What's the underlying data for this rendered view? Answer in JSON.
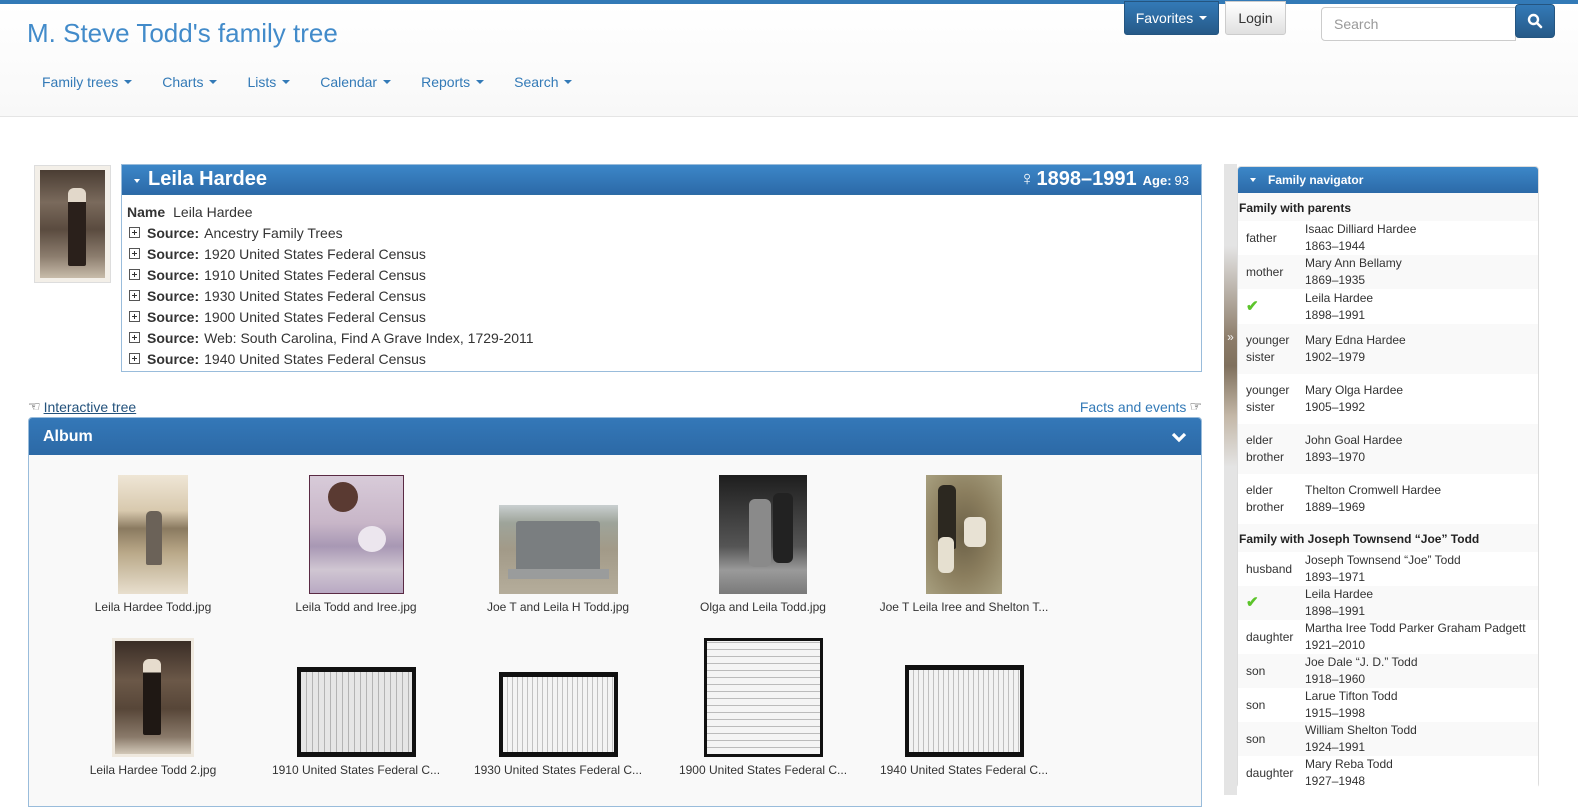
{
  "header": {
    "site_title": "M. Steve Todd's family tree",
    "menu": [
      {
        "label": "Family trees"
      },
      {
        "label": "Charts"
      },
      {
        "label": "Lists"
      },
      {
        "label": "Calendar"
      },
      {
        "label": "Reports"
      },
      {
        "label": "Search"
      }
    ],
    "favorites_label": "Favorites",
    "login_label": "Login",
    "search_placeholder": "Search",
    "search_value": ""
  },
  "colors": {
    "accent": "#337ab7",
    "link": "#428bca",
    "check": "#5cc42b"
  },
  "individual": {
    "name": "Leila Hardee",
    "sex_icon": "female-icon",
    "sex_symbol": "♀",
    "dates": "1898–1991",
    "age_label": "Age:",
    "age": "93",
    "name_fact_label": "Name",
    "name_fact_value": "Leila Hardee",
    "source_label": "Source:",
    "sources": [
      "Ancestry Family Trees",
      "1920 United States Federal Census",
      "1910 United States Federal Census",
      "1930 United States Federal Census",
      "1900 United States Federal Census",
      "Web: South Carolina, Find A Grave Index, 1729-2011",
      "1940 United States Federal Census"
    ]
  },
  "links": {
    "interactive_tree": "Interactive tree",
    "facts_and_events": "Facts and events"
  },
  "album": {
    "title": "Album",
    "items": [
      {
        "caption": "Leila Hardee Todd.jpg"
      },
      {
        "caption": "Leila Todd and Iree.jpg"
      },
      {
        "caption": "Joe T and Leila H Todd.jpg"
      },
      {
        "caption": "Olga and Leila Todd.jpg"
      },
      {
        "caption": "Joe T Leila Iree and Shelton T..."
      },
      {
        "caption": "Leila Hardee Todd 2.jpg"
      },
      {
        "caption": "1910 United States Federal C..."
      },
      {
        "caption": "1930 United States Federal C..."
      },
      {
        "caption": "1900 United States Federal C..."
      },
      {
        "caption": "1940 United States Federal C..."
      }
    ]
  },
  "family_navigator": {
    "title": "Family navigator",
    "families": [
      {
        "label": "Family with parents",
        "members": [
          {
            "relation": "father",
            "name": "Isaac Dilliard Hardee",
            "dates": "1863–1944"
          },
          {
            "relation": "mother",
            "name": "Mary Ann Bellamy",
            "dates": "1869–1935"
          },
          {
            "relation": "",
            "self": true,
            "name": "Leila Hardee",
            "dates": "1898–1991"
          },
          {
            "relation": "younger sister",
            "name": "Mary Edna Hardee",
            "dates": "1902–1979"
          },
          {
            "relation": "younger sister",
            "name": "Mary Olga Hardee",
            "dates": "1905–1992"
          },
          {
            "relation": "elder brother",
            "name": "John Goal Hardee",
            "dates": "1893–1970"
          },
          {
            "relation": "elder brother",
            "name": "Thelton Cromwell Hardee",
            "dates": "1889–1969"
          }
        ]
      },
      {
        "label": "Family with Joseph Townsend “Joe” Todd",
        "members": [
          {
            "relation": "husband",
            "name": "Joseph Townsend “Joe” Todd",
            "dates": "1893–1971"
          },
          {
            "relation": "",
            "self": true,
            "name": "Leila Hardee",
            "dates": "1898–1991"
          },
          {
            "relation": "daughter",
            "name": "Martha Iree Todd Parker Graham Padgett",
            "dates": "1921–2010"
          },
          {
            "relation": "son",
            "name": "Joe Dale “J. D.” Todd",
            "dates": "1918–1960"
          },
          {
            "relation": "son",
            "name": "Larue Tifton Todd",
            "dates": "1915–1998"
          },
          {
            "relation": "son",
            "name": "William Shelton Todd",
            "dates": "1924–1991"
          },
          {
            "relation": "daughter",
            "name": "Mary Reba Todd",
            "dates": "1927–1948"
          }
        ]
      }
    ]
  }
}
